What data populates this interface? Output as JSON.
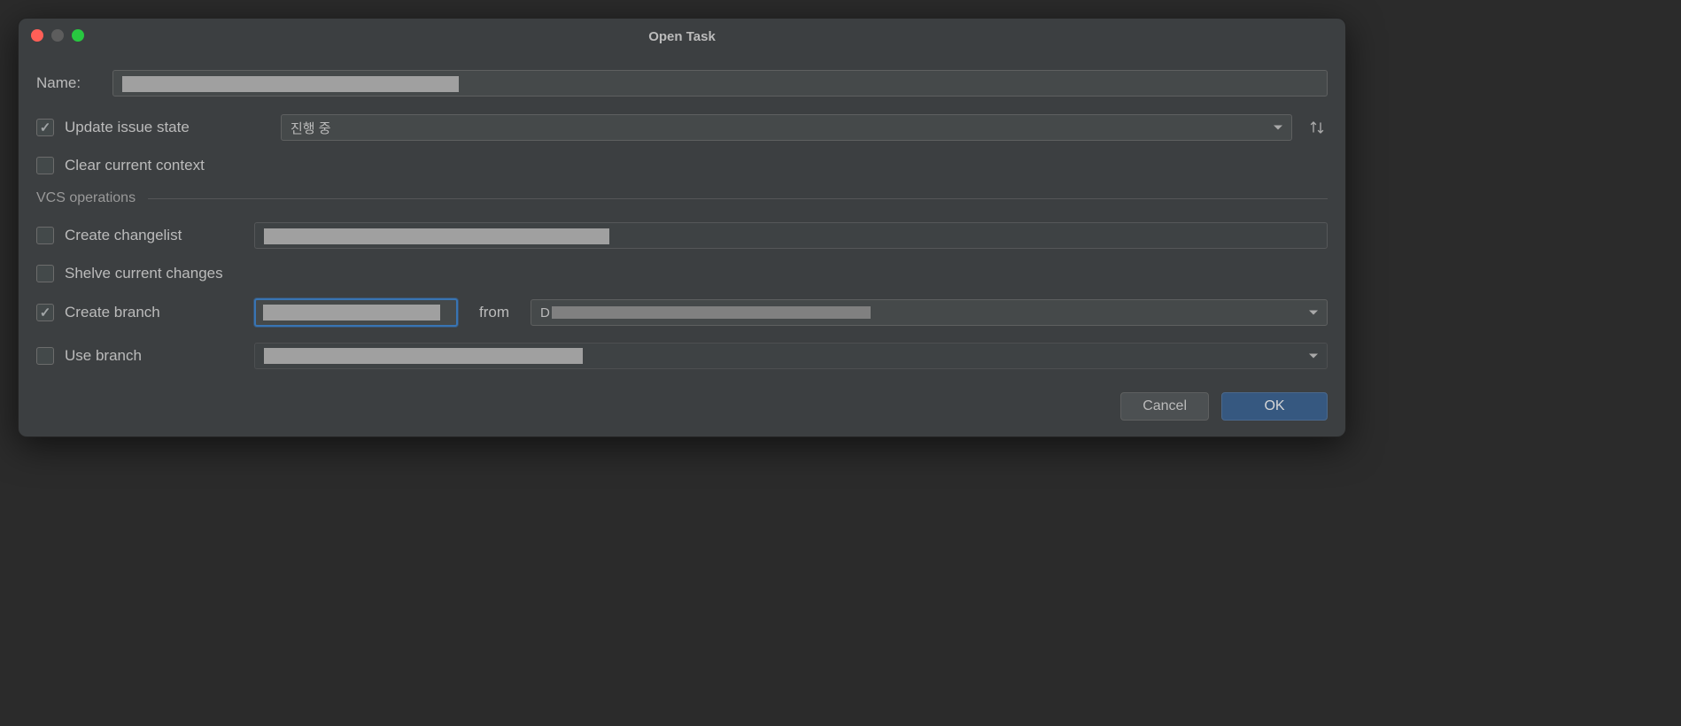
{
  "dialog": {
    "title": "Open Task",
    "name_label": "Name:",
    "name_value": "",
    "update_issue_state": {
      "label": "Update issue state",
      "checked": true,
      "selected": "진행 중"
    },
    "clear_context": {
      "label": "Clear current context",
      "checked": false
    },
    "vcs_section": "VCS operations",
    "create_changelist": {
      "label": "Create changelist",
      "checked": false,
      "value": ""
    },
    "shelve_changes": {
      "label": "Shelve current changes",
      "checked": false
    },
    "create_branch": {
      "label": "Create branch",
      "checked": true,
      "branch_value": "",
      "from_label": "from",
      "from_value": "D"
    },
    "use_branch": {
      "label": "Use branch",
      "checked": false,
      "value": ""
    },
    "buttons": {
      "cancel": "Cancel",
      "ok": "OK"
    }
  }
}
